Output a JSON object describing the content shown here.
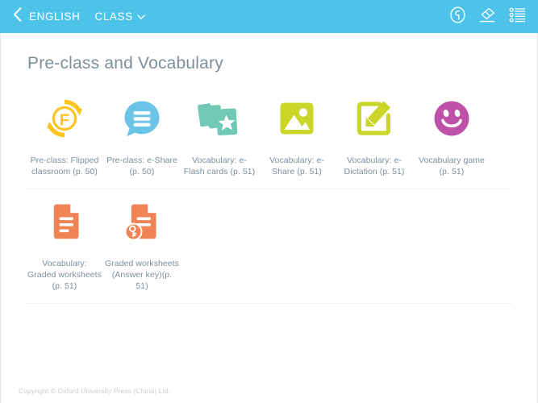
{
  "header": {
    "back_icon": "chevron-left-icon",
    "nav_title": "ENGLISH",
    "class_label": "CLASS",
    "class_caret_icon": "chevron-down-icon",
    "tools": [
      {
        "name": "annotate-pen-icon",
        "label": "Annotate"
      },
      {
        "name": "eraser-icon",
        "label": "Eraser"
      },
      {
        "name": "list-menu-icon",
        "label": "Menu"
      }
    ],
    "background_color": "#4ec3ea"
  },
  "main": {
    "title": "Pre-class and Vocabulary",
    "rows": [
      {
        "tiles": [
          {
            "icon": "flipped-classroom-icon",
            "label": "Pre-class: Flipped classroom (p. 50)",
            "color": "#fbc423"
          },
          {
            "icon": "e-share-chat-icon",
            "label": "Pre-class: e-Share (p. 50)",
            "color": "#6cc3e8"
          },
          {
            "icon": "e-flash-cards-icon",
            "label": "Vocabulary: e-Flash cards (p. 51)",
            "color": "#6fc9b5"
          },
          {
            "icon": "e-share-image-icon",
            "label": "Vocabulary: e-Share (p. 51)",
            "color": "#cbd62a"
          },
          {
            "icon": "e-dictation-pencil-icon",
            "label": "Vocabulary: e-Dictation (p. 51)",
            "color": "#cbd62a"
          },
          {
            "icon": "vocabulary-game-smiley-icon",
            "label": "Vocabulary game (p. 51)",
            "color": "#bd52a8"
          }
        ]
      },
      {
        "tiles": [
          {
            "icon": "graded-worksheets-icon",
            "label": "Vocabulary: Graded worksheets (p. 51)",
            "color": "#ef8354"
          },
          {
            "icon": "graded-worksheets-answer-key-icon",
            "label": "Graded worksheets (Answer key)(p. 51)",
            "color": "#ef8354"
          }
        ]
      }
    ]
  },
  "footer": {
    "copyright": "Copyright © Oxford University Press (China) Ltd."
  }
}
